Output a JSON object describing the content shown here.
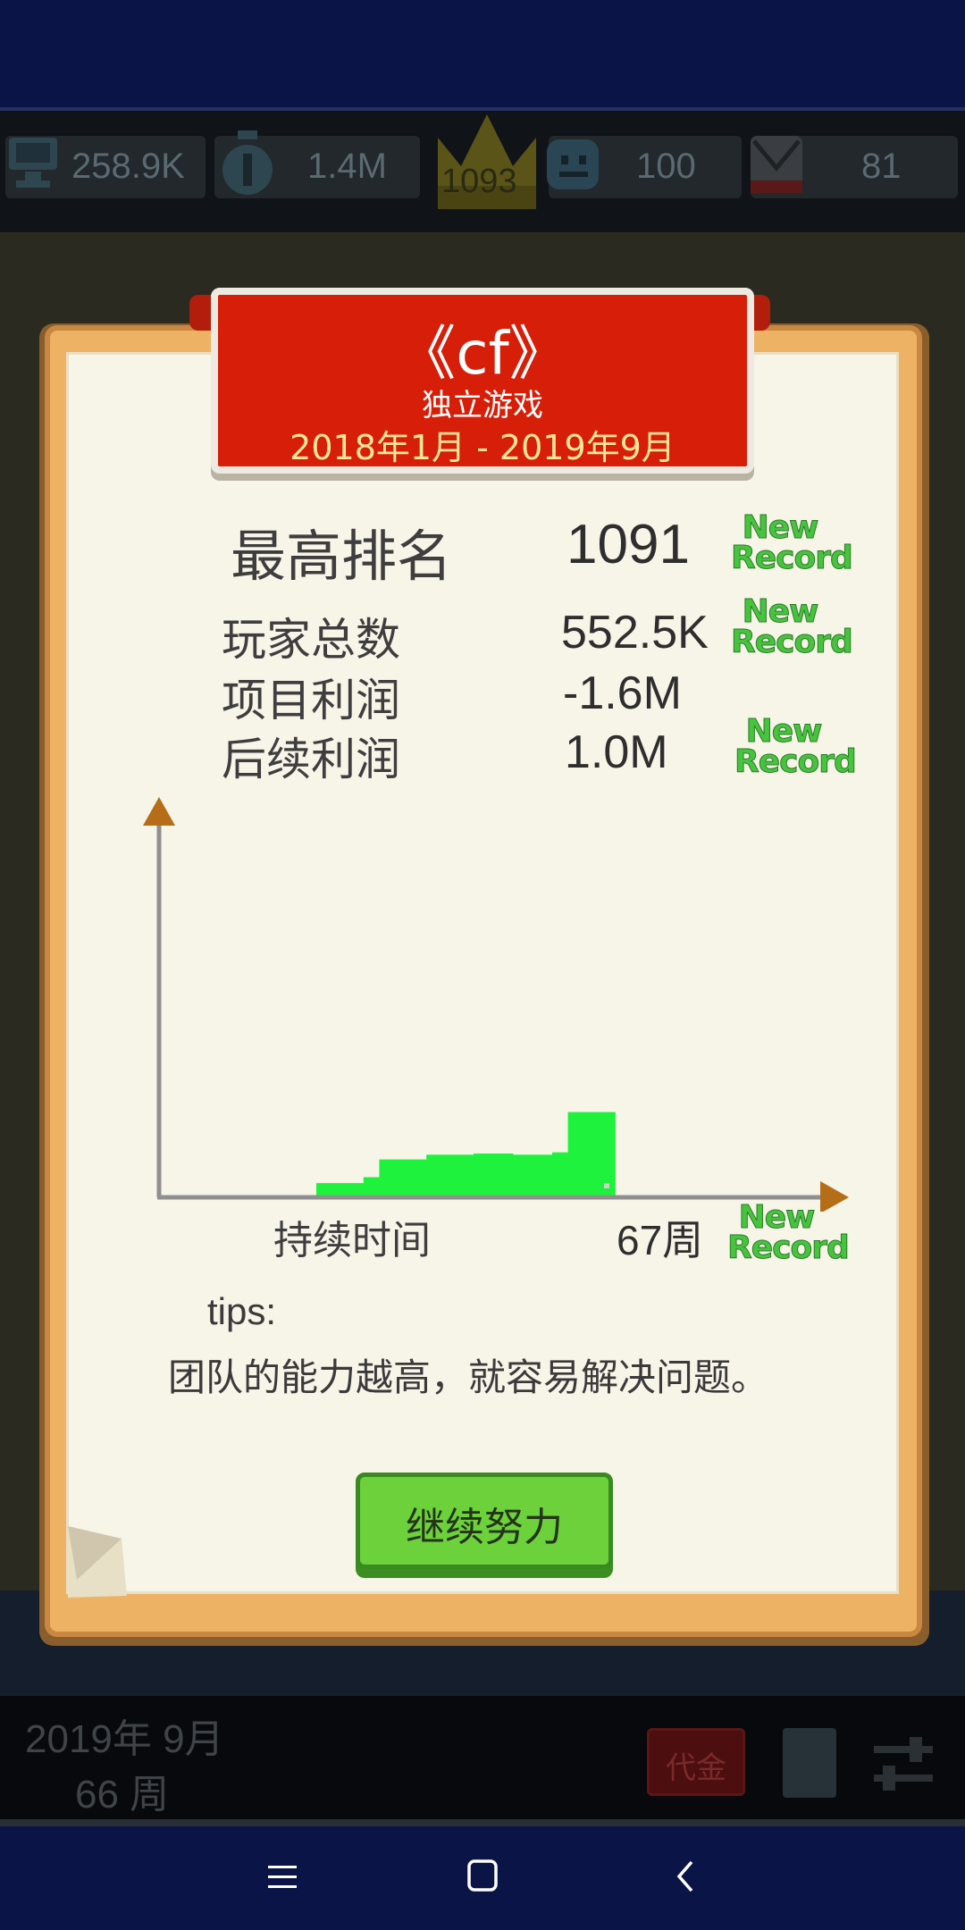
{
  "stats_bar": {
    "fans": "258.9K",
    "money": "1.4M",
    "rank": "1093",
    "happiness": "100",
    "mail": "81"
  },
  "dialog": {
    "title": "《cf》",
    "genre": "独立游戏",
    "date_range": "2018年1月 - 2019年9月",
    "highest_rank_label": "最高排名",
    "highest_rank_value": "1091",
    "players_label": "玩家总数",
    "players_value": "552.5K",
    "profit_label": "项目利润",
    "profit_value": "-1.6M",
    "followup_label": "后续利润",
    "followup_value": "1.0M",
    "new_record_line1": "New",
    "new_record_line2": "Record",
    "duration_label": "持续时间",
    "duration_value": "67周",
    "tips_label": "tips:",
    "tips_text": "团队的能力越高，就容易解决问题。",
    "continue_label": "继续努力"
  },
  "chart_data": {
    "type": "bar",
    "xlabel": "持续时间",
    "ylabel": "",
    "x": [
      1,
      2,
      3,
      4,
      5,
      6,
      7,
      8,
      9,
      10,
      11,
      12,
      13,
      14,
      15,
      16,
      17,
      18,
      19,
      20,
      21,
      22,
      23,
      24,
      25,
      26,
      27,
      28,
      29,
      30,
      31,
      32,
      33,
      34,
      35,
      36,
      37,
      38,
      39,
      40,
      41,
      42,
      43,
      44,
      45,
      46,
      47,
      48,
      49,
      50,
      51,
      52,
      53,
      54,
      55,
      56,
      57,
      58,
      59,
      60,
      61,
      62,
      63,
      64,
      65,
      66,
      67
    ],
    "values": [
      0,
      0,
      0,
      0,
      0,
      0,
      0,
      0,
      0,
      0,
      0,
      0,
      0,
      0,
      0,
      0,
      0,
      0,
      0,
      0,
      0,
      0,
      0,
      0,
      0,
      0,
      0,
      0,
      0,
      0,
      0,
      0,
      0,
      0,
      0,
      0,
      0,
      0,
      0,
      0,
      0,
      0,
      0,
      0,
      0,
      0,
      0,
      0,
      0,
      0,
      0,
      0,
      0,
      0,
      0,
      0,
      0,
      0,
      0,
      0,
      0,
      0,
      0,
      0,
      0,
      0,
      0
    ],
    "bars": [
      {
        "from": 20,
        "to": 26,
        "value": 12
      },
      {
        "from": 26,
        "to": 28,
        "value": 17
      },
      {
        "from": 28,
        "to": 34,
        "value": 32
      },
      {
        "from": 34,
        "to": 40,
        "value": 36
      },
      {
        "from": 40,
        "to": 45,
        "value": 37
      },
      {
        "from": 45,
        "to": 50,
        "value": 36
      },
      {
        "from": 50,
        "to": 52,
        "value": 38
      },
      {
        "from": 52,
        "to": 58,
        "value": 72
      }
    ],
    "xlim": [
      0,
      85
    ],
    "ylim": [
      0,
      320
    ],
    "colors": {
      "bar": "#1ef23c",
      "axis": "#8f8f8f",
      "arrow": "#b56d17"
    }
  },
  "bottom_bar": {
    "date": "2019年 9月",
    "week": "66 周",
    "gold_label": "代金"
  },
  "icons": [
    "monitor-icon",
    "money-bag-icon",
    "crown-icon",
    "smiley-icon",
    "mail-icon",
    "book-icon",
    "settings-icon",
    "menu-icon",
    "home-icon",
    "back-icon"
  ]
}
